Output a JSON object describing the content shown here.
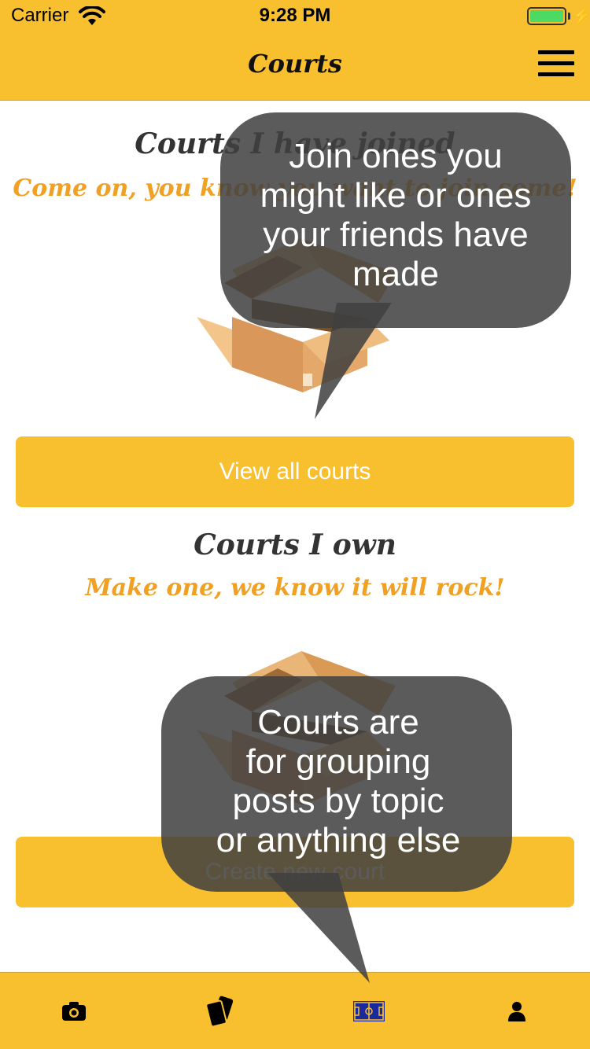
{
  "status_bar": {
    "carrier": "Carrier",
    "time": "9:28 PM"
  },
  "nav": {
    "title": "Courts",
    "menu_icon": "hamburger-menu-icon"
  },
  "joined_section": {
    "title": "Courts I have joined",
    "subtitle": "Come on, you know you want to join some!",
    "button_label": "View all courts"
  },
  "owned_section": {
    "title": "Courts I own",
    "subtitle": "Make one, we know it will rock!",
    "button_label": "Create new court"
  },
  "tabs": [
    {
      "name": "camera",
      "icon": "camera-icon"
    },
    {
      "name": "cards",
      "icon": "cards-icon"
    },
    {
      "name": "courts",
      "icon": "court-icon",
      "selected": true
    },
    {
      "name": "profile",
      "icon": "person-icon"
    }
  ],
  "tooltips": [
    {
      "text": "Join ones you\nmight like or ones\nyour friends have\nmade"
    },
    {
      "text": "Courts are\nfor grouping\nposts by topic\nor anything else"
    }
  ],
  "colors": {
    "accent": "#f8c02e",
    "subtitle": "#f0a022",
    "selected_tab": "#1a2a9c"
  }
}
